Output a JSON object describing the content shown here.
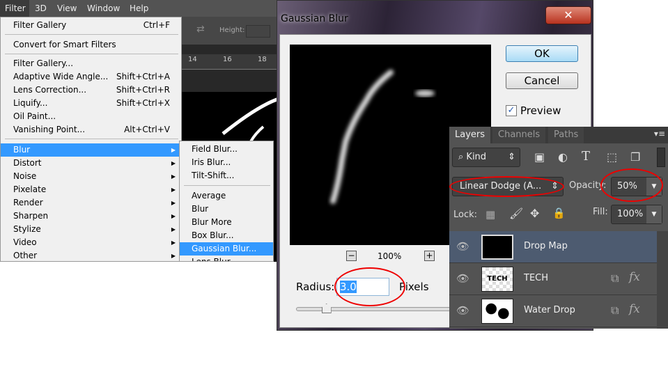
{
  "menubar": {
    "items": [
      "Filter",
      "3D",
      "View",
      "Window",
      "Help"
    ]
  },
  "options_bar": {
    "height_label": "Height:"
  },
  "ruler": {
    "ticks": [
      "14",
      "16",
      "18"
    ]
  },
  "filter_menu": {
    "top": [
      {
        "label": "Filter Gallery",
        "shortcut": "Ctrl+F"
      }
    ],
    "convert": "Convert for Smart Filters",
    "filters": [
      {
        "label": "Filter Gallery...",
        "shortcut": ""
      },
      {
        "label": "Adaptive Wide Angle...",
        "shortcut": "Shift+Ctrl+A"
      },
      {
        "label": "Lens Correction...",
        "shortcut": "Shift+Ctrl+R"
      },
      {
        "label": "Liquify...",
        "shortcut": "Shift+Ctrl+X"
      },
      {
        "label": "Oil Paint...",
        "shortcut": ""
      },
      {
        "label": "Vanishing Point...",
        "shortcut": "Alt+Ctrl+V"
      }
    ],
    "groups": [
      "Blur",
      "Distort",
      "Noise",
      "Pixelate",
      "Render",
      "Sharpen",
      "Stylize",
      "Video",
      "Other"
    ],
    "selected": "Blur"
  },
  "blur_submenu": {
    "top": [
      "Field Blur...",
      "Iris Blur...",
      "Tilt-Shift..."
    ],
    "items": [
      "Average",
      "Blur",
      "Blur More",
      "Box Blur...",
      "Gaussian Blur...",
      "Lens Blur..."
    ],
    "selected": "Gaussian Blur..."
  },
  "dialog": {
    "title": "Gaussian Blur",
    "ok": "OK",
    "cancel": "Cancel",
    "preview_label": "Preview",
    "preview_checked": true,
    "zoom": "100%",
    "radius_label": "Radius:",
    "radius_value": "3.0",
    "units": "Pixels",
    "slider_fraction": 0.19
  },
  "layers_panel": {
    "tabs": [
      "Layers",
      "Channels",
      "Paths"
    ],
    "active_tab": "Layers",
    "filter_kind": "Kind",
    "blend_mode": "Linear Dodge (A...",
    "opacity_label": "Opacity:",
    "opacity": "50%",
    "lock_label": "Lock:",
    "fill_label": "Fill:",
    "fill": "100%",
    "layers": [
      {
        "name": "Drop Map",
        "selected": true
      },
      {
        "name": "TECH",
        "selected": false
      },
      {
        "name": "Water Drop",
        "selected": false
      }
    ],
    "thumb_text": "TECH"
  },
  "colors": {
    "highlight": "#3399ff",
    "annotation": "#ee0000",
    "selected_layer": "#4d5b70"
  }
}
